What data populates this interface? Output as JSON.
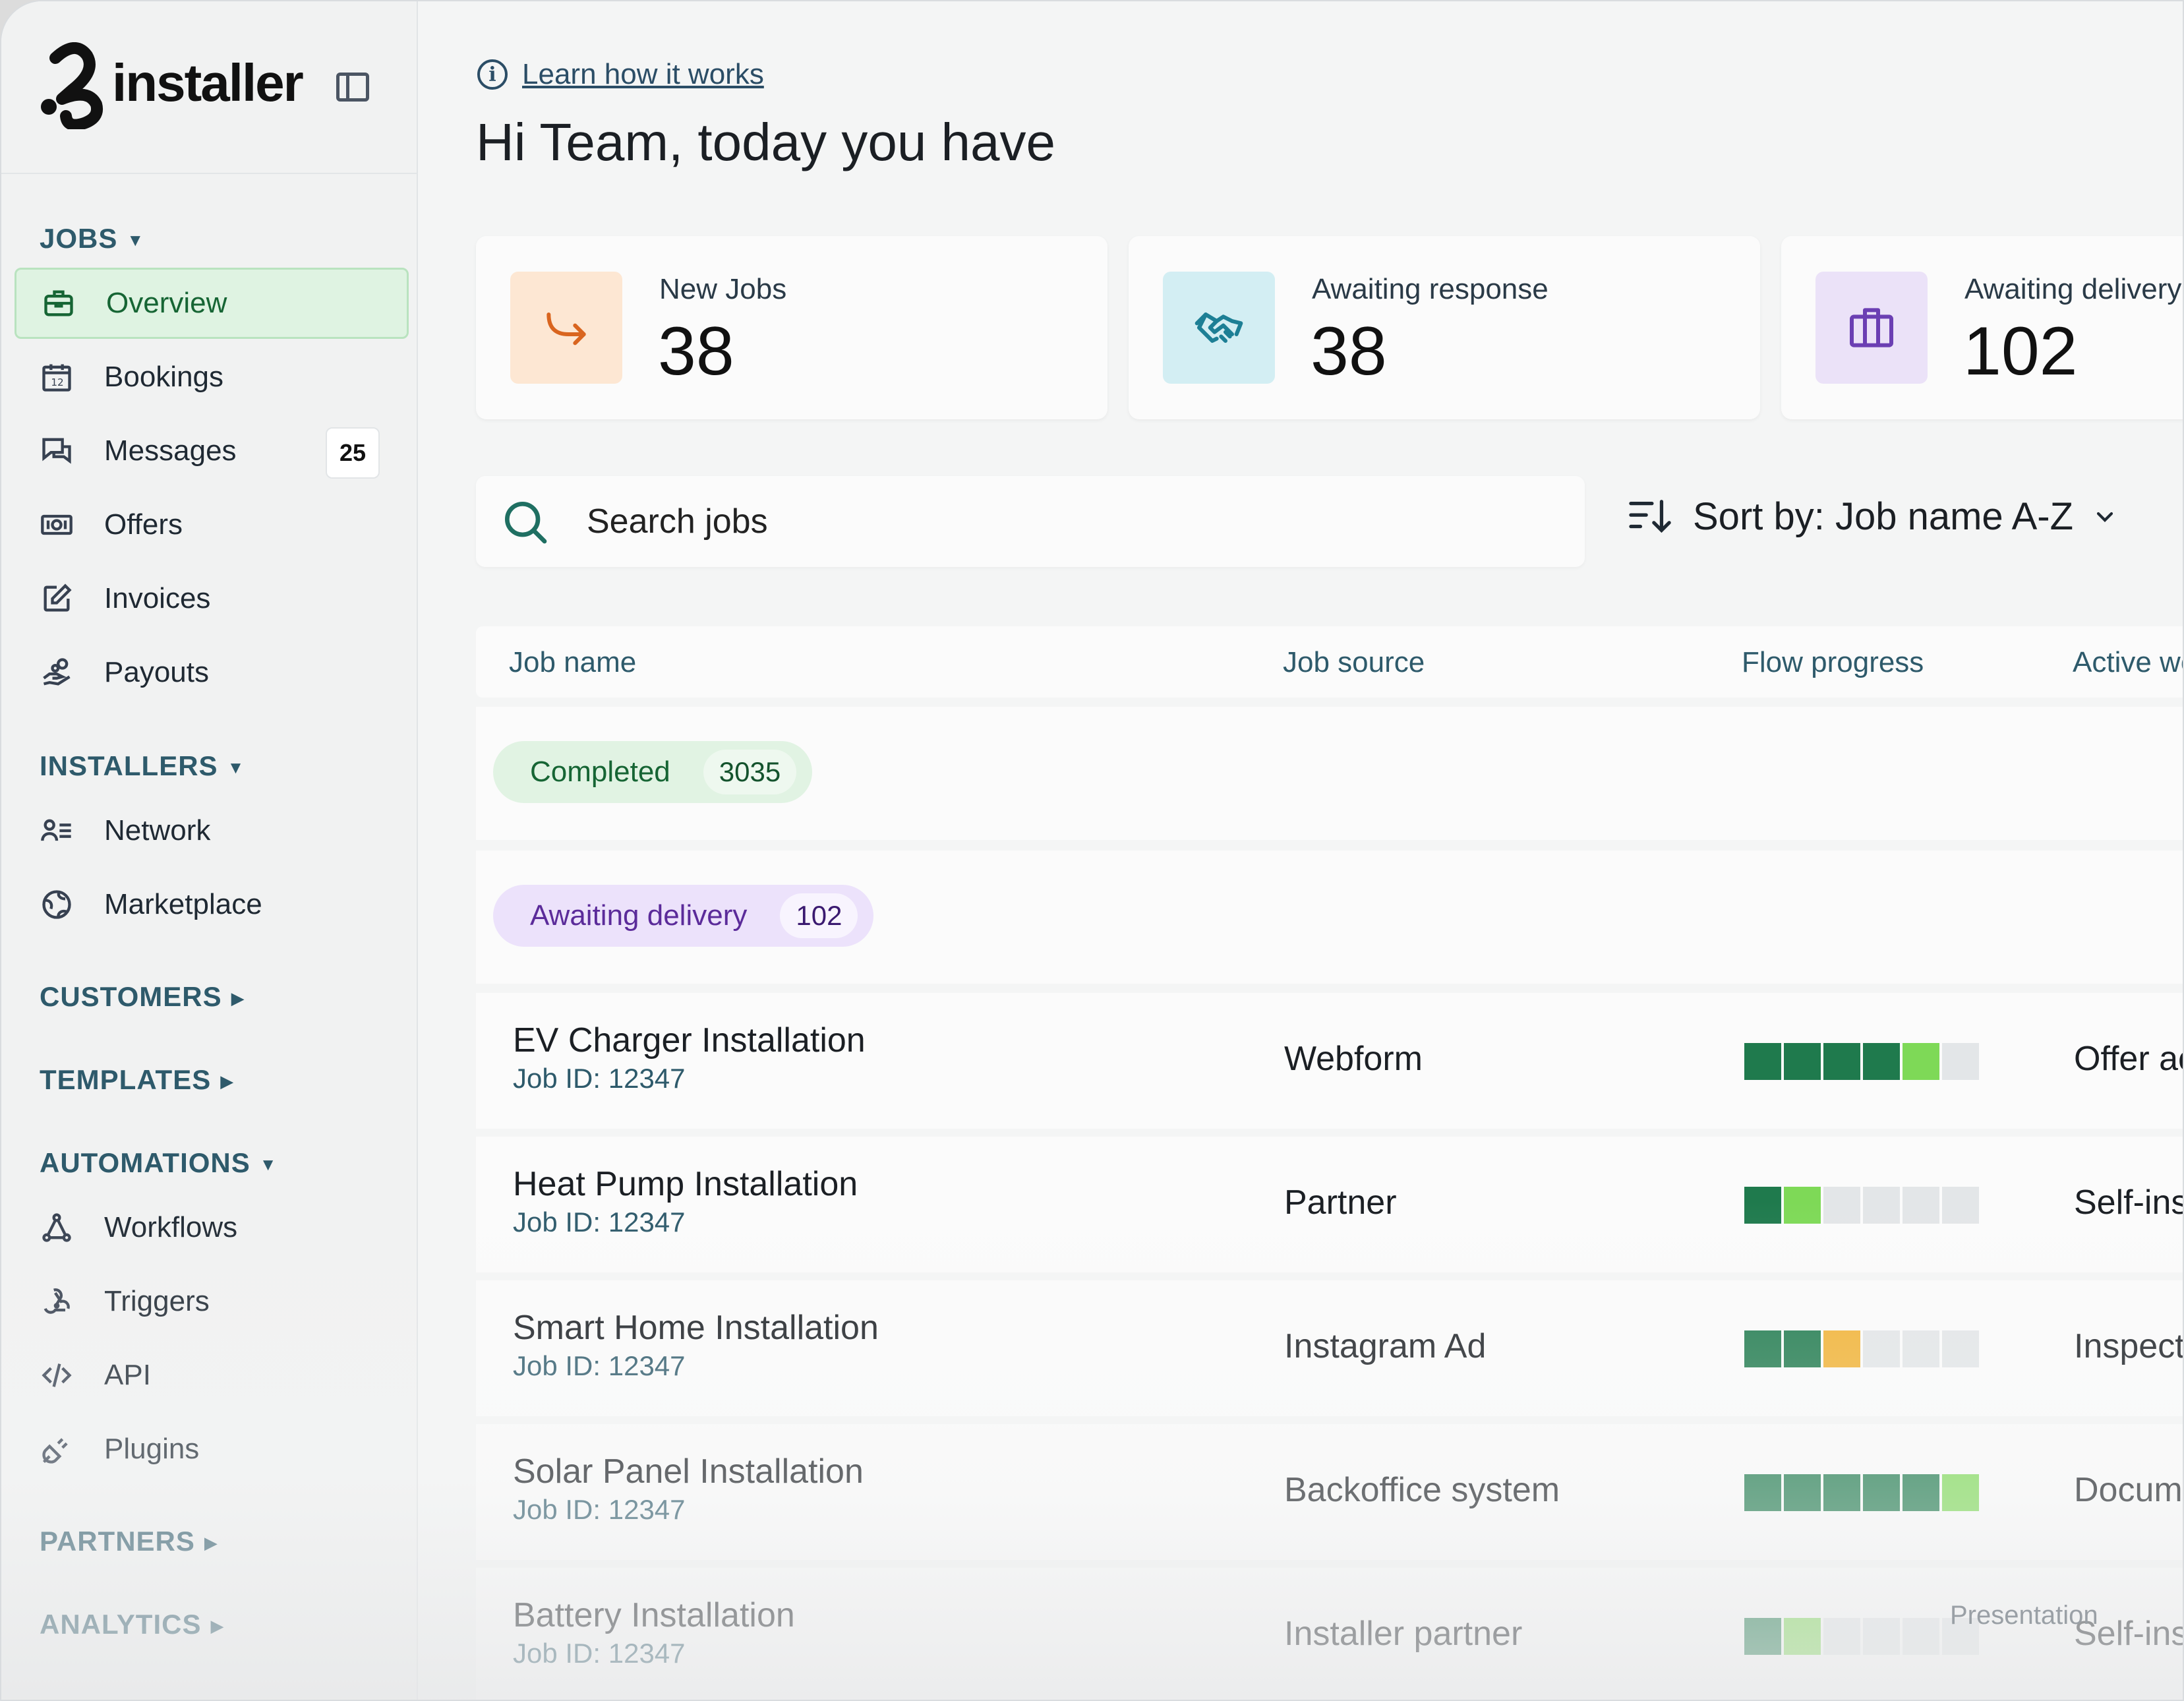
{
  "brand": {
    "name": "installer"
  },
  "sidebar": {
    "sections": {
      "jobs": "JOBS",
      "installers": "INSTALLERS",
      "customers": "CUSTOMERS",
      "templates": "TEMPLATES",
      "automations": "AUTOMATIONS",
      "partners": "PARTNERS",
      "analytics": "ANALYTICS"
    },
    "jobs_items": [
      {
        "label": "Overview",
        "icon": "briefcase-icon",
        "active": true
      },
      {
        "label": "Bookings",
        "icon": "calendar-icon"
      },
      {
        "label": "Messages",
        "icon": "messages-icon",
        "badge": "25"
      },
      {
        "label": "Offers",
        "icon": "banknote-icon"
      },
      {
        "label": "Invoices",
        "icon": "edit-icon"
      },
      {
        "label": "Payouts",
        "icon": "hand-coins-icon"
      }
    ],
    "installers_items": [
      {
        "label": "Network",
        "icon": "user-list-icon"
      },
      {
        "label": "Marketplace",
        "icon": "globe-icon"
      }
    ],
    "automations_items": [
      {
        "label": "Workflows",
        "icon": "workflow-icon"
      },
      {
        "label": "Triggers",
        "icon": "webhook-icon"
      },
      {
        "label": "API",
        "icon": "code-icon"
      },
      {
        "label": "Plugins",
        "icon": "plug-icon"
      }
    ]
  },
  "header": {
    "learn_link": "Learn how it works",
    "greeting": "Hi Team, today you have"
  },
  "stats": [
    {
      "label": "New Jobs",
      "value": "38",
      "icon": "arrow-turn-icon",
      "color": "#fde7d3"
    },
    {
      "label": "Awaiting response",
      "value": "38",
      "icon": "handshake-icon",
      "color": "#d3eef3"
    },
    {
      "label": "Awaiting delivery",
      "value": "102",
      "icon": "package-icon",
      "color": "#ebe2f8"
    }
  ],
  "search": {
    "placeholder": "Search jobs"
  },
  "sort": {
    "label": "Sort by: Job name A-Z"
  },
  "table": {
    "headers": [
      "Job name",
      "Job source",
      "Flow progress",
      "Active workflow"
    ],
    "groups": [
      {
        "label": "Completed",
        "count": "3035"
      },
      {
        "label": "Awaiting delivery",
        "count": "102"
      }
    ],
    "rows": [
      {
        "name": "EV Charger Installation",
        "id": "Job ID: 12347",
        "source": "Webform",
        "workflow": "Offer accepted",
        "progress_done": 4,
        "progress_current": 1,
        "current_color": "#7ed957"
      },
      {
        "name": "Heat Pump Installation",
        "id": "Job ID: 12347",
        "source": "Partner",
        "workflow": "Self-inspection",
        "progress_done": 1,
        "progress_current": 1,
        "current_color": "#7ed957"
      },
      {
        "name": "Smart Home Installation",
        "id": "Job ID: 12347",
        "source": "Instagram Ad",
        "workflow": "Inspection",
        "progress_done": 2,
        "progress_current": 1,
        "current_color": "#f2b233"
      },
      {
        "name": "Solar Panel Installation",
        "id": "Job ID: 12347",
        "source": "Backoffice system",
        "workflow": "Documentation",
        "progress_done": 5,
        "progress_current": 1,
        "current_color": "#7ed957"
      },
      {
        "name": "Battery Installation",
        "id": "Job ID: 12347",
        "source": "Installer partner",
        "workflow": "Self-inspection",
        "progress_done": 1,
        "progress_current": 1,
        "current_color": "#7ed957"
      }
    ],
    "progress_total": 6,
    "progress_done_color": "#1f7a4d"
  },
  "watermark": "Presentation"
}
